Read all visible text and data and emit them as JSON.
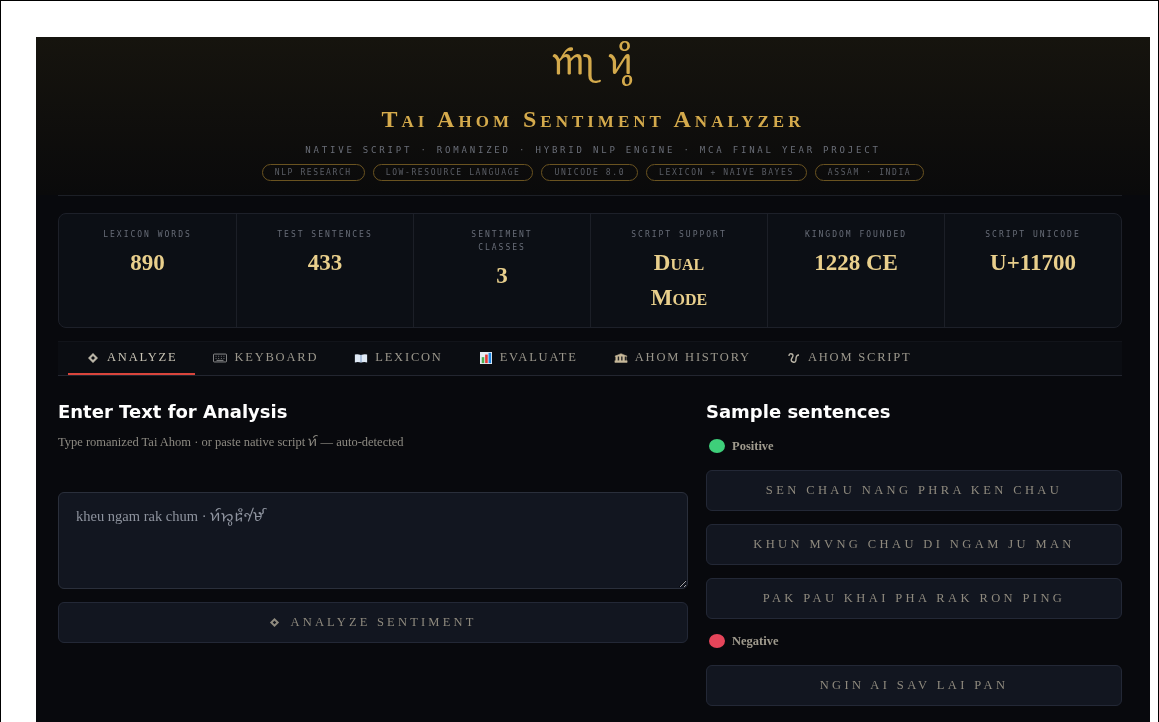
{
  "header": {
    "logo": "𑜒𑜡 𑜑𑜪𑜨",
    "title": "Tai Ahom Sentiment Analyzer",
    "subtitle": "NATIVE SCRIPT · ROMANIZED · HYBRID NLP ENGINE · MCA FINAL YEAR PROJECT",
    "tags": [
      "NLP RESEARCH",
      "LOW-RESOURCE LANGUAGE",
      "UNICODE 8.0",
      "LEXICON + NAIVE BAYES",
      "ASSAM · INDIA"
    ]
  },
  "stats": [
    {
      "label": "LEXICON WORDS",
      "value": "890"
    },
    {
      "label": "TEST SENTENCES",
      "value": "433"
    },
    {
      "label": "SENTIMENT CLASSES",
      "value": "3"
    },
    {
      "label": "SCRIPT SUPPORT",
      "value": "Dual Mode"
    },
    {
      "label": "KINGDOM FOUNDED",
      "value": "1228 CE"
    },
    {
      "label": "SCRIPT UNICODE",
      "value": "U+11700"
    }
  ],
  "tabs": [
    {
      "label": "ANALYZE",
      "selected": true
    },
    {
      "label": "KEYBOARD",
      "selected": false
    },
    {
      "label": "LEXICON",
      "selected": false
    },
    {
      "label": "EVALUATE",
      "selected": false
    },
    {
      "label": "AHOM HISTORY",
      "selected": false
    },
    {
      "label": "AHOM SCRIPT",
      "selected": false
    }
  ],
  "analysis": {
    "heading": "Enter Text for Analysis",
    "hint": "Type romanized Tai Ahom · or paste native script 𑜑𑜫 — auto-detected",
    "value": "kheu ngam rak chum · 𑜑𑜫𑜁𑜨𑜃𑜪𑜉𑜦𑜧",
    "button": "ANALYZE SENTIMENT"
  },
  "samples": {
    "heading": "Sample sentences",
    "groups": [
      {
        "label": "Positive",
        "color": "#3ecf7a",
        "sentences": [
          "SEN CHAU NANG PHRA KEN CHAU",
          "KHUN MVNG CHAU DI NGAM JU MAN",
          "PAK PAU KHAI PHA RAK RON PING"
        ]
      },
      {
        "label": "Negative",
        "color": "#e5455a",
        "sentences": [
          "NGIN AI SAV LAI PAN"
        ]
      }
    ]
  }
}
